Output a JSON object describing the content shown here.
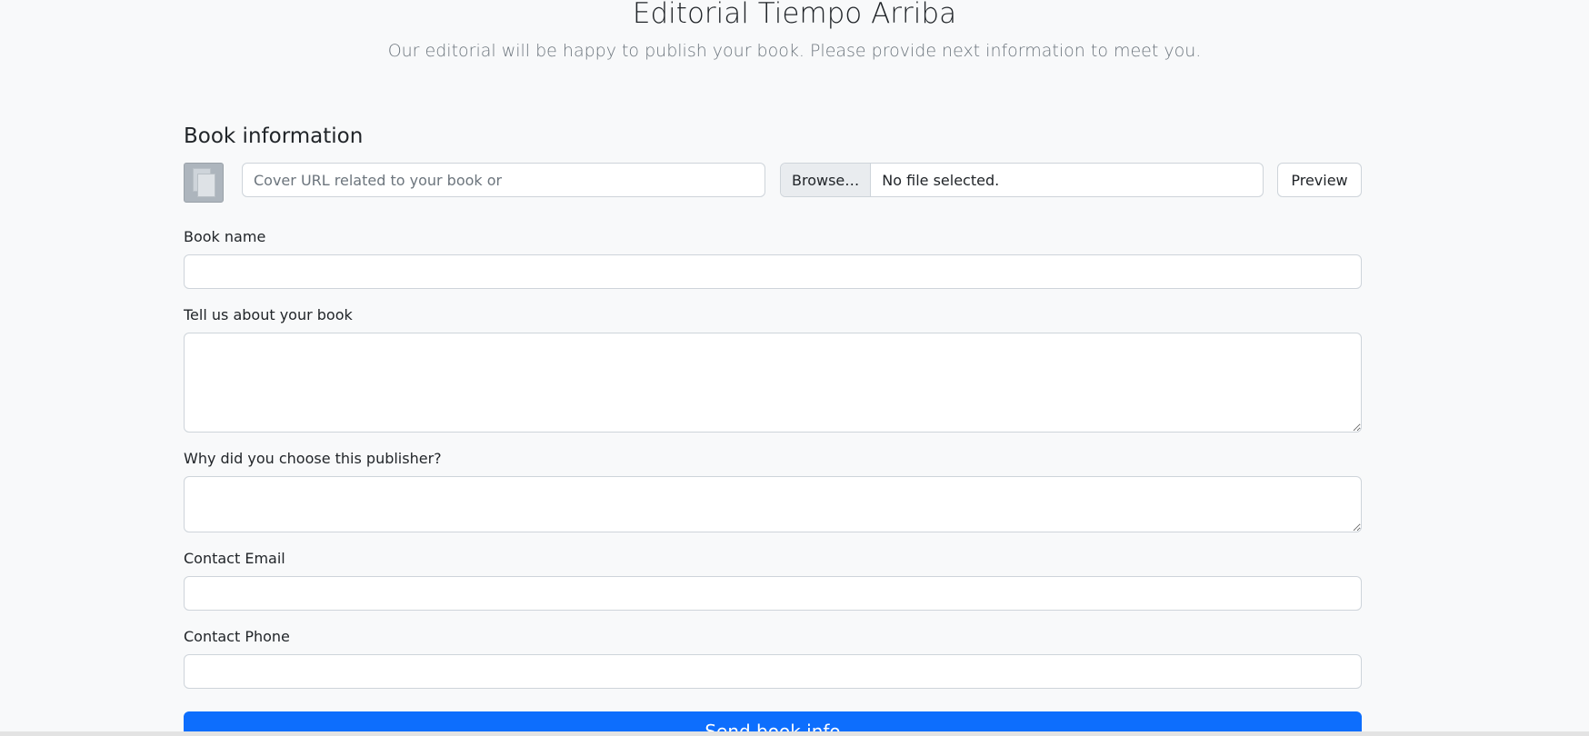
{
  "header": {
    "title": "Editorial Tiempo Arriba",
    "subtitle": "Our editorial will be happy to publish your book. Please provide next information to meet you."
  },
  "book_section": {
    "title": "Book information",
    "cover": {
      "url_placeholder": "Cover URL related to your book or",
      "url_value": "",
      "browse_label": "Browse…",
      "file_status": "No file selected.",
      "preview_label": "Preview",
      "thumbnail_icon": "image-placeholder-icon"
    },
    "fields": {
      "book_name": {
        "label": "Book name",
        "value": ""
      },
      "about": {
        "label": "Tell us about your book",
        "value": ""
      },
      "why_publisher": {
        "label": "Why did you choose this publisher?",
        "value": ""
      },
      "email": {
        "label": "Contact Email",
        "value": ""
      },
      "phone": {
        "label": "Contact Phone",
        "value": ""
      }
    },
    "submit_label": "Send book info"
  },
  "colors": {
    "background": "#f8f9fa",
    "primary": "#0d6efd",
    "border": "#ced4da",
    "muted": "#6c757d"
  }
}
